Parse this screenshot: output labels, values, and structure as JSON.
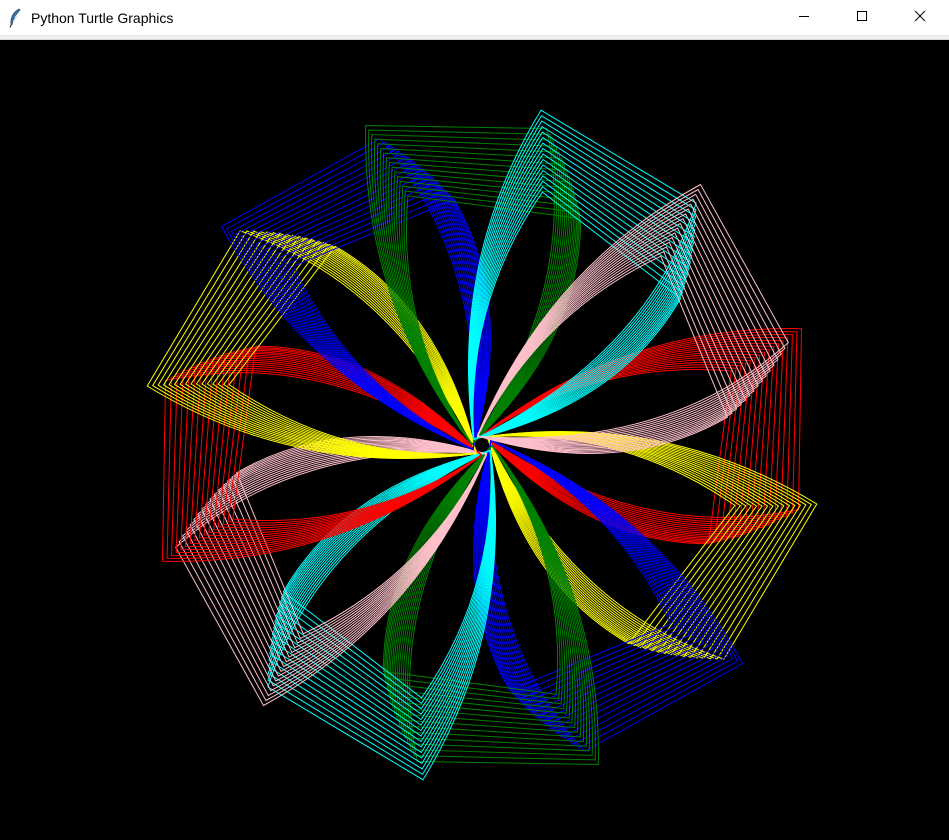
{
  "window": {
    "title": "Python Turtle Graphics",
    "icon": "feather-icon",
    "controls": [
      "minimize-icon",
      "maximize-icon",
      "close-icon"
    ]
  },
  "canvas": {
    "background": "#000000",
    "pattern": "rotating-petal-spiral",
    "petal_colors": [
      "red",
      "yellow",
      "blue",
      "green",
      "cyan",
      "pink",
      "red",
      "yellow",
      "blue",
      "green",
      "cyan",
      "pink"
    ],
    "color_values": {
      "red": "#ff0000",
      "yellow": "#ffff00",
      "blue": "#0000ff",
      "green": "#008000",
      "cyan": "#00ffff",
      "pink": "#ffc0cb"
    },
    "arcs_per_petal": 16
  }
}
